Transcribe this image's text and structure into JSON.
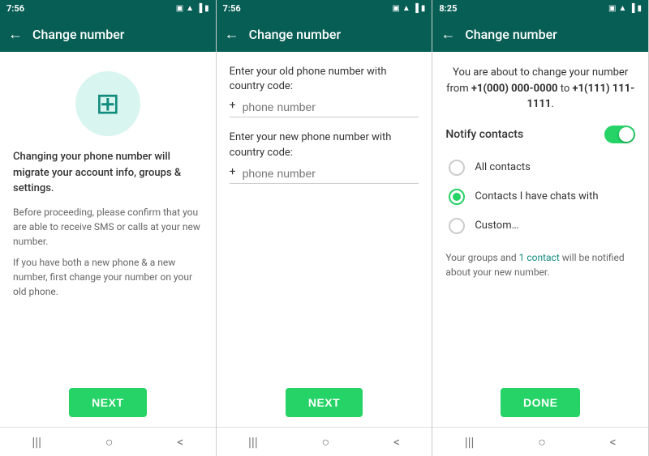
{
  "screens": [
    {
      "id": "screen1",
      "status_time": "7:56",
      "header_title": "Change number",
      "icon_symbol": "⊞",
      "main_text": "Changing your phone number will migrate your account info, groups & settings.",
      "sub_texts": [
        "Before proceeding, please confirm that you are able to receive SMS or calls at your new number.",
        "If you have both a new phone & a new number, first change your number on your old phone."
      ],
      "next_label": "NEXT",
      "nav": [
        "|||",
        "○",
        "<"
      ]
    },
    {
      "id": "screen2",
      "status_time": "7:56",
      "header_title": "Change number",
      "old_label": "Enter your old phone number with country code:",
      "old_placeholder": "phone number",
      "new_label": "Enter your new phone number with country code:",
      "new_placeholder": "phone number",
      "next_label": "NEXT",
      "nav": [
        "|||",
        "○",
        "<"
      ]
    },
    {
      "id": "screen3",
      "status_time": "8:25",
      "header_title": "Change number",
      "info_prefix": "You are about to change your number from ",
      "old_number": "+1(000) 000-0000",
      "info_mid": " to ",
      "new_number": "+1(111) 111-1111",
      "info_suffix": ".",
      "notify_label": "Notify contacts",
      "radio_options": [
        {
          "id": "all",
          "label": "All contacts",
          "selected": false
        },
        {
          "id": "chats",
          "label": "Contacts I have chats with",
          "selected": true
        },
        {
          "id": "custom",
          "label": "Custom…",
          "selected": false
        }
      ],
      "groups_text_prefix": "Your groups and ",
      "contact_link_text": "1 contact",
      "groups_text_suffix": " will be notified about your new number.",
      "done_label": "DONE",
      "nav": [
        "|||",
        "○",
        "<"
      ]
    }
  ]
}
